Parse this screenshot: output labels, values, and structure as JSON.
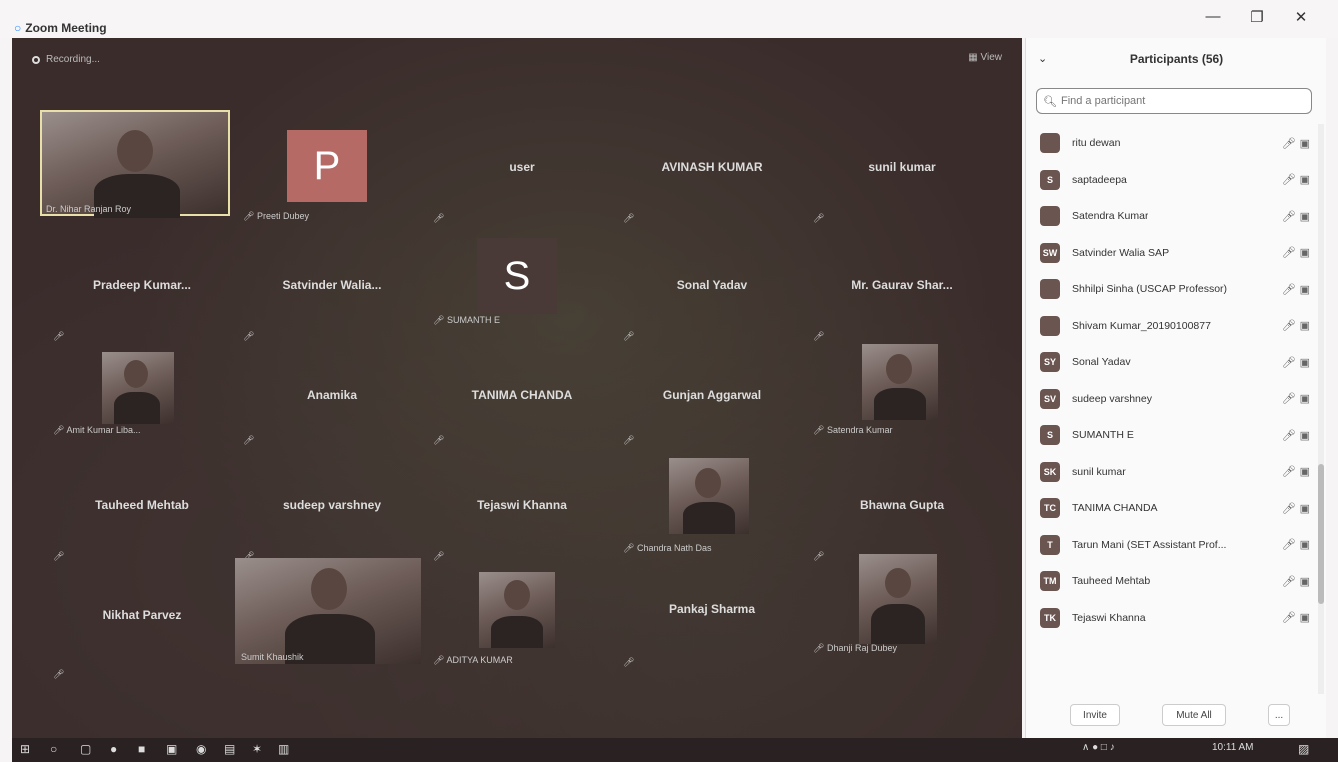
{
  "window": {
    "title": "Zoom Meeting",
    "minimize_icon": "—",
    "maximize_icon": "❐",
    "close_icon": "✕"
  },
  "meeting": {
    "recording_label": "Recording...",
    "view_label": "View"
  },
  "tiles": {
    "t1": {
      "label": "Dr. Nihar Ranjan Roy"
    },
    "t2": {
      "avatar_letter": "P",
      "label": "Preeti Dubey"
    },
    "t3": {
      "name": "user"
    },
    "t4": {
      "name": "AVINASH KUMAR"
    },
    "t5": {
      "name": "sunil kumar"
    },
    "t6": {
      "name": "Pradeep Kumar..."
    },
    "t7": {
      "name": "Satvinder Walia..."
    },
    "t8": {
      "avatar_letter": "S",
      "label": "SUMANTH E"
    },
    "t9": {
      "name": "Sonal Yadav"
    },
    "t10": {
      "name": "Mr. Gaurav Shar..."
    },
    "t11": {
      "label": "Amit Kumar Liba..."
    },
    "t12": {
      "name": "Anamika"
    },
    "t13": {
      "name": "TANIMA CHANDA"
    },
    "t14": {
      "name": "Gunjan Aggarwal"
    },
    "t15": {
      "label": "Satendra Kumar"
    },
    "t16": {
      "name": "Tauheed Mehtab"
    },
    "t17": {
      "name": "sudeep varshney"
    },
    "t18": {
      "name": "Tejaswi Khanna"
    },
    "t19": {
      "label": "Chandra Nath Das"
    },
    "t20": {
      "name": "Bhawna Gupta"
    },
    "t21": {
      "name": "Nikhat Parvez"
    },
    "t22": {
      "label": "Sumit Khaushik"
    },
    "t23": {
      "label": "ADITYA KUMAR"
    },
    "t24": {
      "name": "Pankaj Sharma"
    },
    "t25": {
      "label": "Dhanji Raj Dubey"
    }
  },
  "panel": {
    "title": "Participants (56)",
    "search_placeholder": "Find a participant",
    "participants": [
      {
        "initials": "",
        "name": "ritu dewan"
      },
      {
        "initials": "S",
        "name": "saptadeepa"
      },
      {
        "initials": "",
        "name": "Satendra Kumar"
      },
      {
        "initials": "SW",
        "name": "Satvinder Walia SAP"
      },
      {
        "initials": "",
        "name": "Shhilpi Sinha (USCAP Professor)"
      },
      {
        "initials": "",
        "name": "Shivam Kumar_20190100877"
      },
      {
        "initials": "SY",
        "name": "Sonal Yadav"
      },
      {
        "initials": "SV",
        "name": "sudeep varshney"
      },
      {
        "initials": "S",
        "name": "SUMANTH E"
      },
      {
        "initials": "SK",
        "name": "sunil kumar"
      },
      {
        "initials": "TC",
        "name": "TANIMA CHANDA"
      },
      {
        "initials": "T",
        "name": "Tarun Mani (SET Assistant Prof..."
      },
      {
        "initials": "TM",
        "name": "Tauheed Mehtab"
      },
      {
        "initials": "TK",
        "name": "Tejaswi Khanna"
      }
    ],
    "invite_label": "Invite",
    "mute_all_label": "Mute All",
    "more_label": "..."
  },
  "taskbar": {
    "time": "10:11 AM"
  },
  "colors": {
    "meeting_bg": "#3a2c2b",
    "avatar_p": "#b56a66",
    "avatar_s": "#4a3a37"
  }
}
